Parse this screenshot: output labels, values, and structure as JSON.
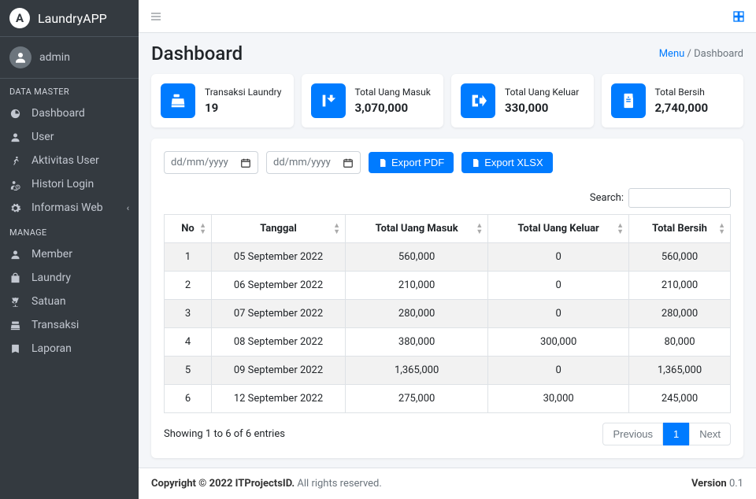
{
  "app": {
    "name": "LaundryAPP"
  },
  "user": {
    "name": "admin"
  },
  "sidebar": {
    "headers": {
      "master": "DATA MASTER",
      "manage": "MANAGE"
    },
    "master": [
      {
        "label": "Dashboard"
      },
      {
        "label": "User"
      },
      {
        "label": "Aktivitas User"
      },
      {
        "label": "Histori Login"
      },
      {
        "label": "Informasi Web"
      }
    ],
    "manage": [
      {
        "label": "Member"
      },
      {
        "label": "Laundry"
      },
      {
        "label": "Satuan"
      },
      {
        "label": "Transaksi"
      },
      {
        "label": "Laporan"
      }
    ]
  },
  "page": {
    "title": "Dashboard"
  },
  "breadcrumb": {
    "root": "Menu",
    "sep": "/",
    "current": "Dashboard"
  },
  "cards": [
    {
      "label": "Transaksi Laundry",
      "value": "19"
    },
    {
      "label": "Total Uang Masuk",
      "value": "3,070,000"
    },
    {
      "label": "Total Uang Keluar",
      "value": "330,000"
    },
    {
      "label": "Total Bersih",
      "value": "2,740,000"
    }
  ],
  "toolbar": {
    "date_placeholder": "dd/mm/yyyy",
    "export_pdf": "Export PDF",
    "export_xlsx": "Export XLSX"
  },
  "search": {
    "label": "Search:"
  },
  "table": {
    "headers": {
      "no": "No",
      "tanggal": "Tanggal",
      "masuk": "Total Uang Masuk",
      "keluar": "Total Uang Keluar",
      "bersih": "Total Bersih"
    },
    "rows": [
      {
        "no": "1",
        "tanggal": "05 September 2022",
        "masuk": "560,000",
        "keluar": "0",
        "bersih": "560,000"
      },
      {
        "no": "2",
        "tanggal": "06 September 2022",
        "masuk": "210,000",
        "keluar": "0",
        "bersih": "210,000"
      },
      {
        "no": "3",
        "tanggal": "07 September 2022",
        "masuk": "280,000",
        "keluar": "0",
        "bersih": "280,000"
      },
      {
        "no": "4",
        "tanggal": "08 September 2022",
        "masuk": "380,000",
        "keluar": "300,000",
        "bersih": "80,000"
      },
      {
        "no": "5",
        "tanggal": "09 September 2022",
        "masuk": "1,365,000",
        "keluar": "0",
        "bersih": "1,365,000"
      },
      {
        "no": "6",
        "tanggal": "12 September 2022",
        "masuk": "275,000",
        "keluar": "30,000",
        "bersih": "245,000"
      }
    ],
    "info": "Showing 1 to 6 of 6 entries",
    "pagination": {
      "prev": "Previous",
      "page": "1",
      "next": "Next"
    }
  },
  "footer": {
    "copy_strong": "Copyright © 2022 ITProjectsID.",
    "copy_rest": " All rights reserved.",
    "version_label": "Version ",
    "version_value": "0.1"
  }
}
